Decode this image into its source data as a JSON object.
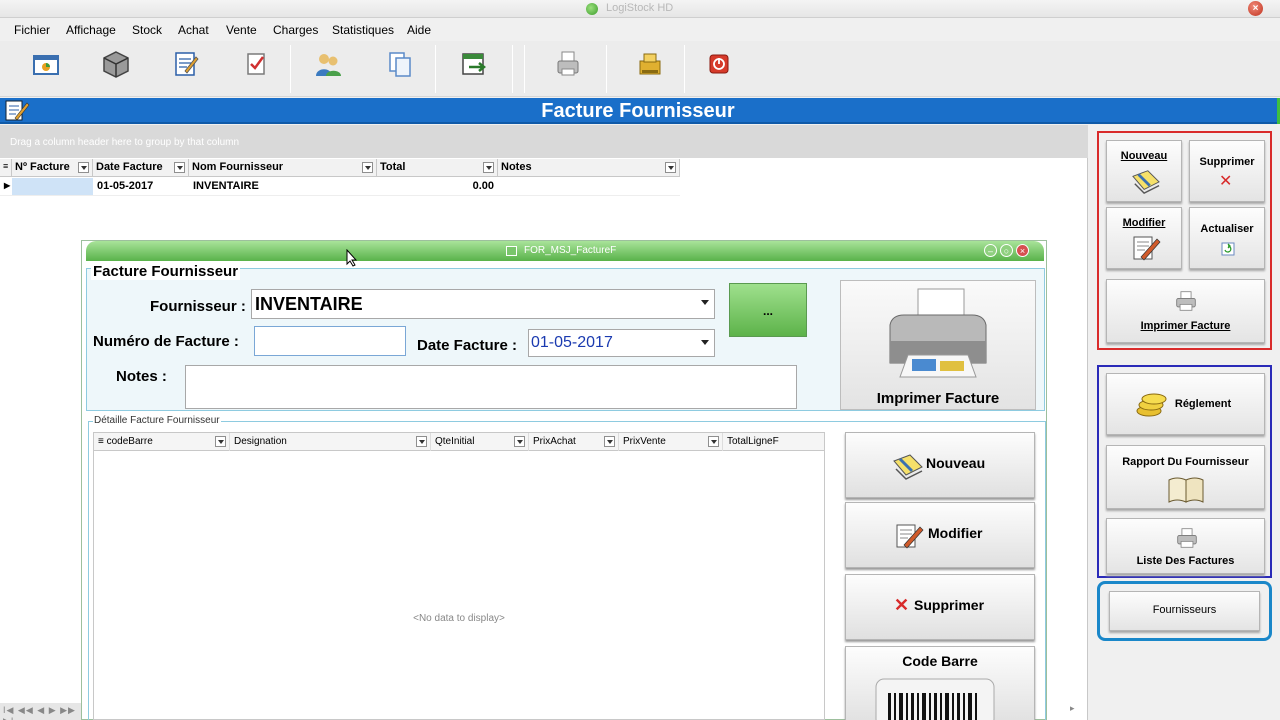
{
  "window": {
    "title": "LogiStock HD",
    "close_symbol": "×"
  },
  "menu": [
    "Fichier",
    "Affichage",
    "Stock",
    "Achat",
    "Vente",
    "Charges",
    "Statistiques",
    "Aide"
  ],
  "page": {
    "title": "Facture Fournisseur"
  },
  "grid": {
    "group_hint": "Drag a column header here to group by that column",
    "columns": [
      "Nº Facture",
      "Date Facture",
      "Nom Fournisseur",
      "Total",
      "Notes"
    ],
    "rows": [
      {
        "num": "",
        "date": "01-05-2017",
        "fournisseur": "INVENTAIRE",
        "total": "0.00",
        "notes": ""
      }
    ],
    "nav": "I◀ ◀◀ ◀ ▶ ▶▶ ▶I"
  },
  "dialog": {
    "title": "FOR_MSJ_FactureF",
    "section_title": "Facture Fournisseur",
    "fournisseur_label": "Fournisseur :",
    "fournisseur_value": "INVENTAIRE",
    "ellipsis_label": "...",
    "numero_label": "Numéro de Facture :",
    "numero_value": "",
    "date_label": "Date Facture :",
    "date_value": "01-05-2017",
    "notes_label": "Notes :",
    "notes_value": "",
    "print_label": "Imprimer Facture",
    "details_title": "Détaille Facture Fournisseur",
    "detail_columns": [
      "codeBarre",
      "Designation",
      "QteInitial",
      "PrixAchat",
      "PrixVente",
      "TotalLigneF"
    ],
    "no_data": "<No data to display>",
    "buttons": {
      "nouveau": "Nouveau",
      "modifier": "Modifier",
      "supprimer": "Supprimer",
      "code_barre": "Code Barre"
    }
  },
  "side": {
    "nouveau": "Nouveau",
    "supprimer": "Supprimer",
    "modifier": "Modifier",
    "actualiser": "Actualiser",
    "imprimer": "Imprimer Facture",
    "reglement": "Réglement",
    "rapport": "Rapport Du Fournisseur",
    "liste": "Liste Des Factures",
    "fournisseurs": "Fournisseurs"
  },
  "colors": {
    "header_blue": "#1a6fc9",
    "group_red": "#d92b2b",
    "group_navy": "#2a2ab8",
    "group_cyan": "#1a87c9",
    "dialog_green": "#59b24a"
  }
}
